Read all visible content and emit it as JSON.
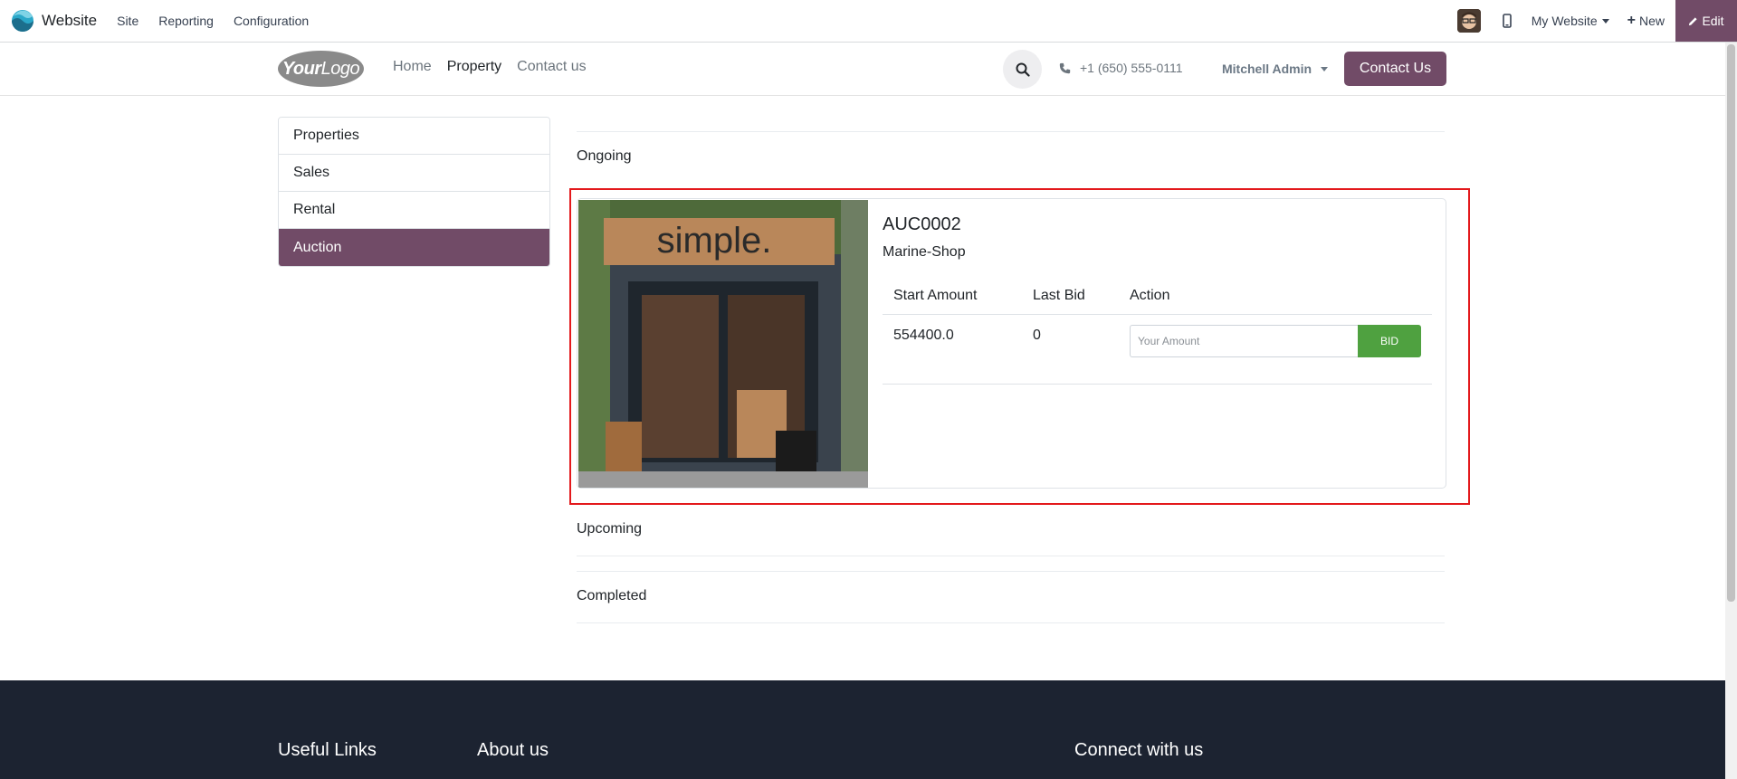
{
  "admin_bar": {
    "app_name": "Website",
    "menu": [
      "Site",
      "Reporting",
      "Configuration"
    ],
    "my_website": "My Website",
    "new_label": "New",
    "edit_label": "Edit"
  },
  "header": {
    "logo_text_bold": "Your",
    "logo_text": "Logo",
    "nav": [
      "Home",
      "Property",
      "Contact us"
    ],
    "phone": "+1 (650) 555-0111",
    "user": "Mitchell Admin",
    "contact_button": "Contact Us"
  },
  "sidebar": {
    "items": [
      {
        "label": "Properties"
      },
      {
        "label": "Sales"
      },
      {
        "label": "Rental"
      },
      {
        "label": "Auction",
        "active": true
      }
    ]
  },
  "main": {
    "sections": {
      "ongoing": "Ongoing",
      "upcoming": "Upcoming",
      "completed": "Completed"
    },
    "auction": {
      "code": "AUC0002",
      "name": "Marine-Shop",
      "image_sign": "simple.",
      "columns": [
        "Start Amount",
        "Last Bid",
        "Action"
      ],
      "start_amount": "554400.0",
      "last_bid": "0",
      "amount_placeholder": "Your Amount",
      "bid_label": "BID"
    }
  },
  "footer": {
    "useful_links": "Useful Links",
    "about_us": "About us",
    "connect": "Connect with us"
  },
  "colors": {
    "brand": "#714b67",
    "bid_green": "#4fa140",
    "highlight_red": "#e3191c",
    "footer_bg": "#1c2331"
  }
}
